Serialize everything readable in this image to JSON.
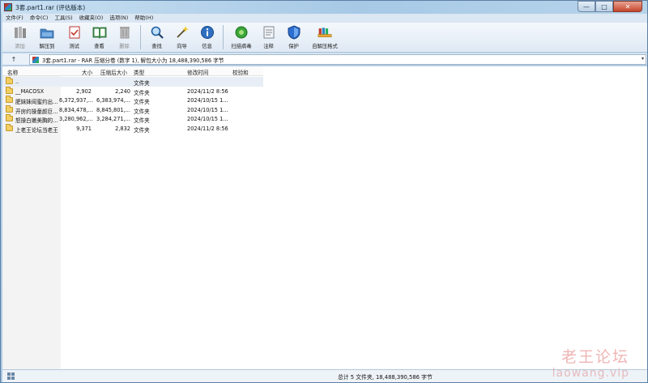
{
  "window": {
    "title": "3套.part1.rar (评估版本)",
    "controls": {
      "minimize": "—",
      "maximize": "□",
      "close": "✕"
    }
  },
  "menu": [
    "文件(F)",
    "命令(C)",
    "工具(S)",
    "收藏夹(O)",
    "选项(N)",
    "帮助(H)"
  ],
  "toolbar": [
    {
      "label": "添加",
      "icon": "add-books-icon",
      "disabled": true
    },
    {
      "label": "解压到",
      "icon": "extract-folder-icon",
      "disabled": false
    },
    {
      "label": "测试",
      "icon": "test-checklist-icon",
      "disabled": false
    },
    {
      "label": "查看",
      "icon": "view-book-icon",
      "disabled": false
    },
    {
      "label": "删除",
      "icon": "trash-bin-icon",
      "disabled": true
    },
    {
      "label": "查找",
      "icon": "magnifier-icon",
      "disabled": false
    },
    {
      "label": "向导",
      "icon": "magic-wand-icon",
      "disabled": false
    },
    {
      "label": "信息",
      "icon": "info-icon",
      "disabled": false
    },
    {
      "label": "扫描病毒",
      "icon": "virus-scan-icon",
      "disabled": false
    },
    {
      "label": "注释",
      "icon": "comment-icon",
      "disabled": false
    },
    {
      "label": "保护",
      "icon": "shield-icon",
      "disabled": false
    },
    {
      "label": "自解压格式",
      "icon": "sfx-archive-icon",
      "disabled": false
    }
  ],
  "address": {
    "up_label": "↑",
    "path": "3套.part1.rar - RAR 压缩分卷 (数字 1), 解包大小为 18,488,390,586 字节",
    "dropdown": "▾"
  },
  "columns": {
    "name": "名称",
    "size": "大小",
    "packed": "压缩后大小",
    "type": "类型",
    "modified": "修改时间",
    "crc": "校验和"
  },
  "rows": [
    {
      "name": "..",
      "size": "",
      "packed": "",
      "type": "文件夹",
      "modified": "",
      "crc": ""
    },
    {
      "name": "__MACOSX",
      "size": "2,902",
      "packed": "2,240",
      "type": "文件夹",
      "modified": "2024/11/2 8:56",
      "crc": ""
    },
    {
      "name": "肥妹妹闺蜜约出...",
      "size": "6,372,937,...",
      "packed": "6,383,974,...",
      "type": "文件夹",
      "modified": "2024/10/15 1...",
      "crc": ""
    },
    {
      "name": "开房约操童颜巨...",
      "size": "8,834,478,...",
      "packed": "8,845,801,...",
      "type": "文件夹",
      "modified": "2024/10/15 1...",
      "crc": ""
    },
    {
      "name": "怒操白嫩美胸的...",
      "size": "3,280,962,...",
      "packed": "3,284,271,...",
      "type": "文件夹",
      "modified": "2024/10/15 1...",
      "crc": ""
    },
    {
      "name": "上老王论坛当老王",
      "size": "9,371",
      "packed": "2,832",
      "type": "文件夹",
      "modified": "2024/11/2 8:56",
      "crc": ""
    }
  ],
  "status": {
    "text": "总计 5 文件夹, 18,488,390,586 字节"
  },
  "watermark": {
    "cn": "老王论坛",
    "en": "laowang.vip"
  }
}
